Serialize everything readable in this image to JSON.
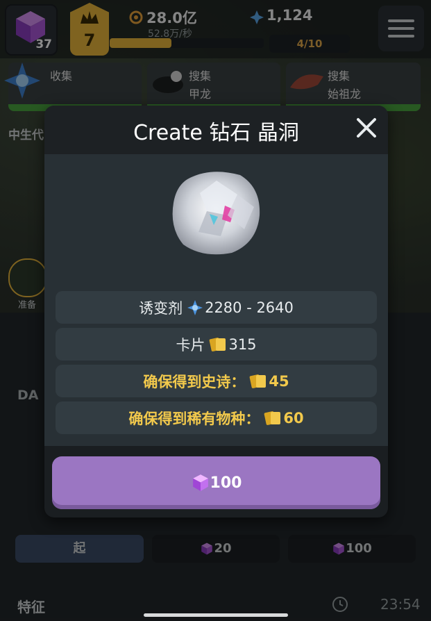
{
  "hud": {
    "dna_count": "37",
    "level": "7",
    "coins": "28.0亿",
    "coins_rate": "52.8万/秒",
    "mutagen": "1,124",
    "xp_fraction": 0.4,
    "progress": "4/10"
  },
  "tasks": [
    {
      "title": "收集",
      "subtitle": ""
    },
    {
      "title": "搜集",
      "subtitle": "甲龙"
    },
    {
      "title": "搜集",
      "subtitle": "始祖龙"
    }
  ],
  "side": {
    "era_label": "中生代",
    "prepare_label": "准备",
    "da_label": "DA"
  },
  "bottom": {
    "btn1_label": "起",
    "btn2_value": "20",
    "btn3_value": "100",
    "feature_label": "特征",
    "clock": "23:54"
  },
  "modal": {
    "title": "Create 钻石 晶洞",
    "rows": [
      {
        "label": "诱变剂",
        "value": "2280 - 2640",
        "icon": "mutagen-icon"
      },
      {
        "label": "卡片",
        "value": "315",
        "icon": "cards-icon"
      },
      {
        "label": "确保得到史诗：",
        "value": "45",
        "icon": "cards-icon"
      },
      {
        "label": "确保得到稀有物种：",
        "value": "60",
        "icon": "cards-icon"
      }
    ],
    "button_value": "100"
  },
  "colors": {
    "gold": "#f2c94c",
    "button_purple": "#9b76c2",
    "panel": "#283035",
    "row": "#323c42"
  }
}
